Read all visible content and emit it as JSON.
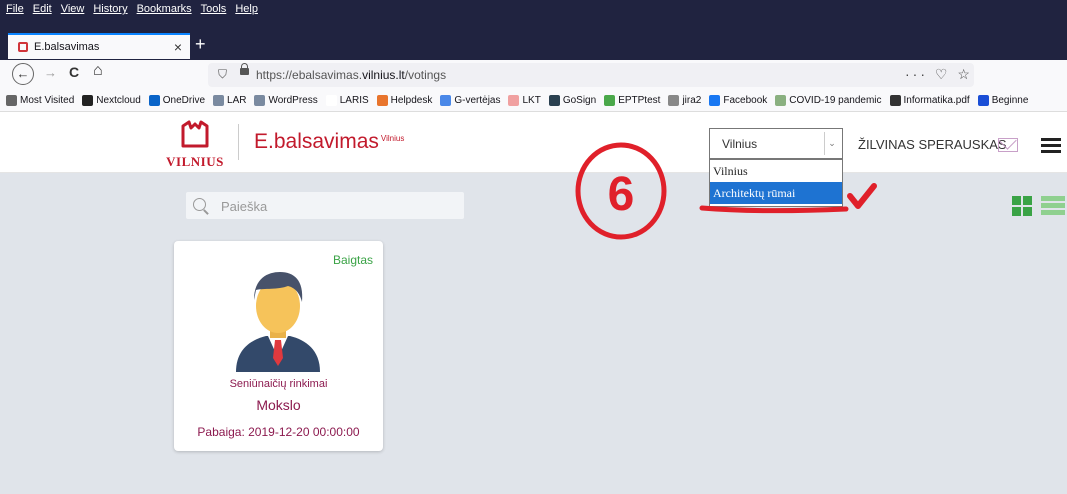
{
  "menubar": {
    "items": [
      "File",
      "Edit",
      "View",
      "History",
      "Bookmarks",
      "Tools",
      "Help"
    ]
  },
  "tab": {
    "title": "E.balsavimas",
    "close": "×",
    "new": "+"
  },
  "nav": {
    "back": "←",
    "forward": "→",
    "reload": "C",
    "home": "⌂"
  },
  "url": {
    "prefix": "https://ebalsavimas.",
    "host": "vilnius.lt",
    "path": "/votings",
    "more": "···",
    "pocket": "♡",
    "star": "☆"
  },
  "bookmarks": [
    {
      "label": "Most Visited",
      "color": "#666666",
      "icon": "gear-icon"
    },
    {
      "label": "Nextcloud",
      "color": "#222222",
      "icon": "folder-icon"
    },
    {
      "label": "OneDrive",
      "color": "#0a64c8",
      "icon": "cloud-icon"
    },
    {
      "label": "LAR",
      "color": "#7a8aa0",
      "icon": "doc-icon"
    },
    {
      "label": "WordPress",
      "color": "#7a8aa0",
      "icon": "doc-icon"
    },
    {
      "label": "LARIS",
      "color": "#ffffff",
      "icon": "blank-icon"
    },
    {
      "label": "Helpdesk",
      "color": "#e8742c",
      "icon": "helpdesk-icon"
    },
    {
      "label": "G-vertėjas",
      "color": "#4a88e8",
      "icon": "translate-icon"
    },
    {
      "label": "LKT",
      "color": "#f0a0a0",
      "icon": "lkt-icon"
    },
    {
      "label": "GoSign",
      "color": "#2a4050",
      "icon": "gosign-icon"
    },
    {
      "label": "EPTPtest",
      "color": "#4aa84a",
      "icon": "eptp-icon"
    },
    {
      "label": "jira2",
      "color": "#888888",
      "icon": "jira-icon"
    },
    {
      "label": "Facebook",
      "color": "#1877f2",
      "icon": "facebook-icon"
    },
    {
      "label": "COVID-19 pandemic",
      "color": "#8ab080",
      "icon": "covid-icon"
    },
    {
      "label": "Informatika.pdf",
      "color": "#333333",
      "icon": "globe-icon"
    },
    {
      "label": "Beginne",
      "color": "#1a4ed6",
      "icon": "lu-icon"
    }
  ],
  "header": {
    "logo_text": "VILNIUS",
    "brand": "E.balsavimas",
    "brand_sup": "Vilnius",
    "select_value": "Vilnius",
    "user": "ŽILVINAS SPERAUSKAS"
  },
  "dropdown": {
    "options": [
      "Vilnius",
      "Architektų rūmai"
    ],
    "selected_index": 1
  },
  "search": {
    "placeholder": "Paieška"
  },
  "card": {
    "status": "Baigtas",
    "type": "Seniūnaičių rinkimai",
    "title": "Mokslo",
    "deadline": "Pabaiga: 2019-12-20 00:00:00"
  },
  "annotation": {
    "step": "6",
    "color": "#e0202a"
  },
  "colors": {
    "brand": "#c21a2c",
    "accent_green": "#3aa346",
    "card_text": "#8c1a4f",
    "selected": "#1e73d2"
  }
}
